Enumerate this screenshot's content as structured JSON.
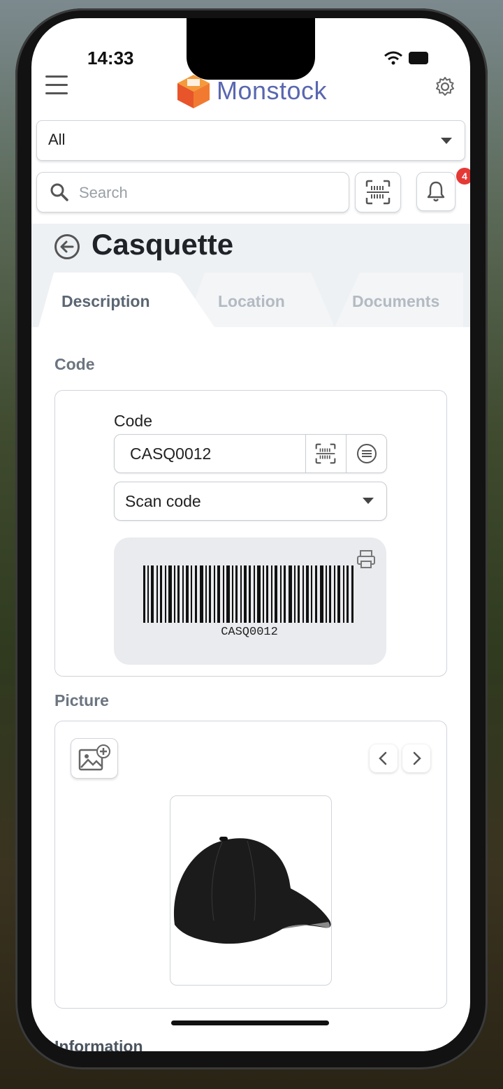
{
  "status_bar": {
    "time": "14:33"
  },
  "header": {
    "logo_text": "Monstock"
  },
  "filter": {
    "selected": "All"
  },
  "search": {
    "placeholder": "Search"
  },
  "notifications": {
    "count": "4"
  },
  "page": {
    "title": "Casquette"
  },
  "tabs": [
    {
      "label": "Description",
      "active": true
    },
    {
      "label": "Location",
      "active": false
    },
    {
      "label": "Documents",
      "active": false
    }
  ],
  "code_section": {
    "title": "Code",
    "field_label": "Code",
    "value": "CASQ0012",
    "scan_mode": "Scan code",
    "barcode_text": "CASQ0012"
  },
  "picture_section": {
    "title": "Picture",
    "image_alt": "black cap"
  },
  "information_section": {
    "title": "Information"
  },
  "colors": {
    "brand": "#5967b0",
    "badge": "#e53935",
    "logo_orange": "#f26a2e"
  }
}
